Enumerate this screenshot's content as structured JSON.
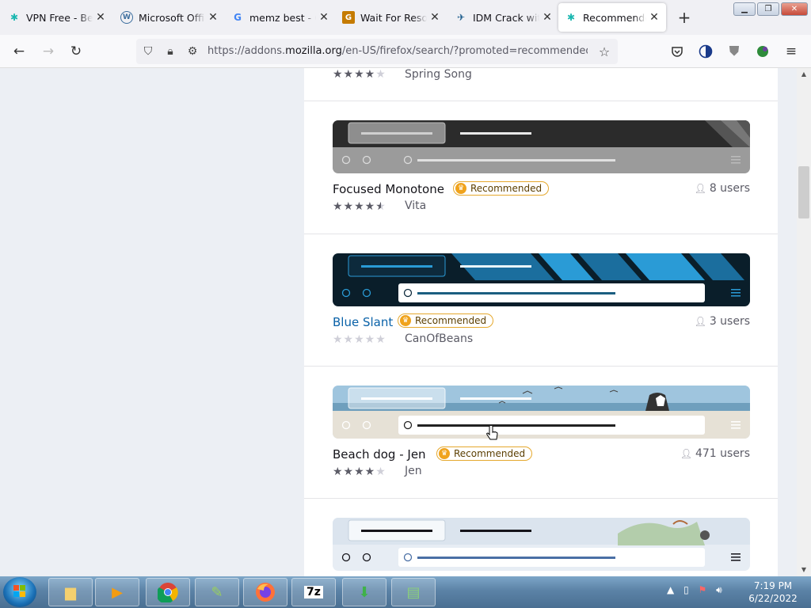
{
  "tabs": [
    {
      "title": "VPN Free - Better",
      "fav": "✱",
      "fav_color": "#1bb7b0"
    },
    {
      "title": "Microsoft Office",
      "fav": "W",
      "fav_color": "#3c6e9e"
    },
    {
      "title": "memz best - Go",
      "fav": "G",
      "fav_color": "#4285f4"
    },
    {
      "title": "Wait For Resour",
      "fav": "G",
      "fav_color": "#c57b00"
    },
    {
      "title": "IDM Crack with",
      "fav": "✈",
      "fav_color": "#1c5c8c"
    },
    {
      "title": "Recommended",
      "fav": "✱",
      "fav_color": "#1bb7b0"
    }
  ],
  "url": {
    "prefix": "https://addons.",
    "domain": "mozilla.org",
    "suffix": "/en-US/firefox/search/?promoted=recommended&so"
  },
  "results": {
    "first_author": "Spring Song",
    "first_rating": 4,
    "items": [
      {
        "name": "Focused Monotone",
        "badge": "Recommended",
        "users": "8 users",
        "author": "Vita",
        "rating": 4.5
      },
      {
        "name": "Blue Slant",
        "badge": "Recommended",
        "users": "3 users",
        "author": "CanOfBeans",
        "rating": 0
      },
      {
        "name": "Beach dog - Jen",
        "badge": "Recommended",
        "users": "471 users",
        "author": "Jen",
        "rating": 4
      }
    ]
  },
  "taskbar": {
    "time": "7:19 PM",
    "date": "6/22/2022"
  },
  "colors": {
    "link": "#0a62a8",
    "badge_border": "#e5a82d",
    "star_on": "#5b5b66",
    "star_off": "#cfcfd8"
  }
}
